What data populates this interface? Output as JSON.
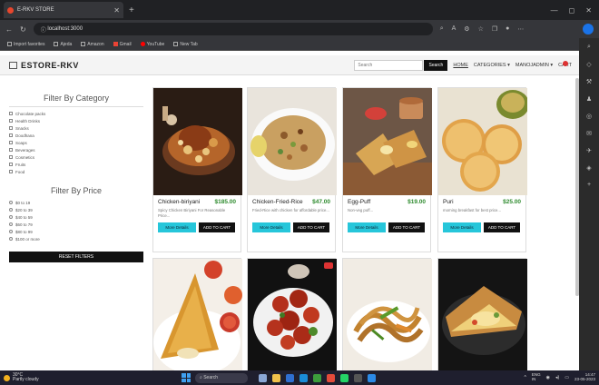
{
  "browser": {
    "tab_title": "E-RKV STORE",
    "url": "localhost:3000",
    "bookmarks": [
      "Import favorites",
      "Ajeda",
      "Amazon",
      "Gmail",
      "YouTube",
      "New Tab"
    ]
  },
  "navbar": {
    "brand": "ESTORE-RKV",
    "search_placeholder": "Search",
    "search_button": "Search",
    "links": [
      "HOME",
      "CATEGORIES ▾",
      "MANOJADMIN ▾",
      "CART"
    ]
  },
  "filters": {
    "category_title": "Filter By Category",
    "categories": [
      "Chocolate packs",
      "Health Drinks",
      "Snacks",
      "Doodhana",
      "Soaps",
      "Beverages",
      "Cosmetics",
      "Fruits",
      "Food"
    ],
    "price_title": "Filter By Price",
    "prices": [
      "$0 to 19",
      "$20 to 39",
      "$40 to 59",
      "$60 to 79",
      "$80 to 99",
      "$100 or more"
    ],
    "reset_label": "RESET FILTERS"
  },
  "products": [
    {
      "name": "Chicken-biriyani",
      "price": "$185.00",
      "desc": "Spicy Chicken Biriyani For Reasonable Price...",
      "more": "More Details",
      "add": "ADD TO CART"
    },
    {
      "name": "Chicken-Fried-Rice",
      "price": "$47.00",
      "desc": "Fried-Rice with chicken for affordable price...",
      "more": "More Details",
      "add": "ADD TO CART"
    },
    {
      "name": "Egg-Puff",
      "price": "$19.00",
      "desc": "Non-veg puff...",
      "more": "More Details",
      "add": "ADD TO CART"
    },
    {
      "name": "Puri",
      "price": "$25.00",
      "desc": "morning breakfast for best price...",
      "more": "More Details",
      "add": "ADD TO CART"
    }
  ],
  "taskbar": {
    "weather_temp": "30°C",
    "weather_desc": "Partly cloudy",
    "search": "Search",
    "lang": "ENG",
    "lang2": "IN",
    "time": "14:47",
    "date": "23-05-2023"
  }
}
